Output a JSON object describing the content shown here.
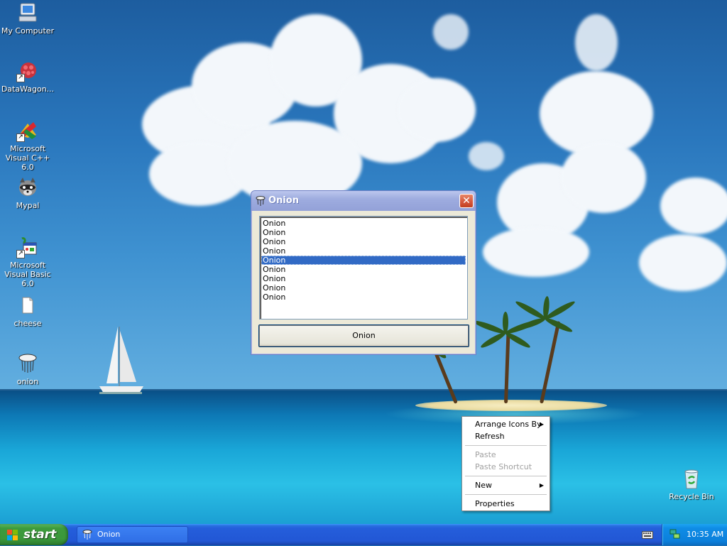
{
  "desktop": {
    "icons": [
      {
        "label": "My Computer",
        "icon": "my-computer-icon"
      },
      {
        "label": "DataWagon...",
        "icon": "datawagon-icon"
      },
      {
        "label": "Microsoft Visual C++ 6.0",
        "icon": "visual-cpp-icon"
      },
      {
        "label": "Mypal",
        "icon": "mypal-raccoon-icon"
      },
      {
        "label": "Microsoft Visual Basic 6.0",
        "icon": "visual-basic-icon"
      },
      {
        "label": "cheese",
        "icon": "folder-icon"
      },
      {
        "label": "onion",
        "icon": "onion-icon"
      },
      {
        "label": "Recycle Bin",
        "icon": "recycle-bin-icon"
      }
    ]
  },
  "window": {
    "title": "Onion",
    "close_glyph": "✕",
    "list_items": [
      "Onion",
      "Onion",
      "Onion",
      "Onion",
      "Onion",
      "Onion",
      "Onion",
      "Onion",
      "Onion"
    ],
    "selected_index": 4,
    "button_label": "Onion"
  },
  "context_menu": {
    "items": [
      {
        "label": "Arrange Icons By",
        "submenu": true,
        "enabled": true
      },
      {
        "label": "Refresh",
        "submenu": false,
        "enabled": true
      },
      {
        "label": "Paste",
        "submenu": false,
        "enabled": false
      },
      {
        "label": "Paste Shortcut",
        "submenu": false,
        "enabled": false
      },
      {
        "label": "New",
        "submenu": true,
        "enabled": true
      },
      {
        "label": "Properties",
        "submenu": false,
        "enabled": true
      }
    ],
    "submenu_glyph": "▶"
  },
  "taskbar": {
    "start_label": "start",
    "task_label": "Onion",
    "clock": "10:35 AM"
  },
  "colors": {
    "selection": "#316ac5",
    "taskbar": "#245edb",
    "start_green": "#3c9a3c",
    "tray": "#0f8ce6"
  }
}
